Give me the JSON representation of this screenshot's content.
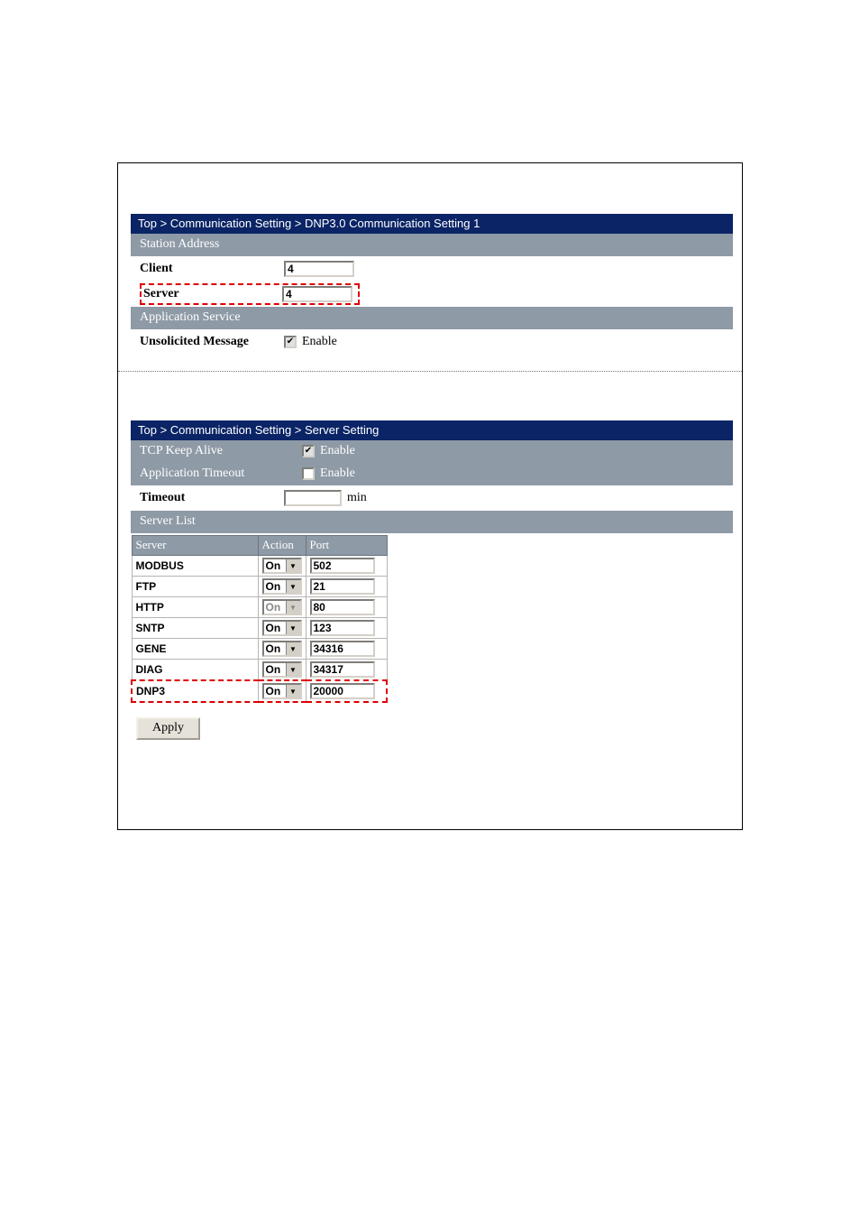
{
  "top": {
    "breadcrumb": "Top > Communication Setting > DNP3.0 Communication Setting 1",
    "section_station_address": "Station Address",
    "client_label": "Client",
    "client_value": "4",
    "server_label": "Server",
    "server_value": "4",
    "section_app_service": "Application Service",
    "unsolicited_label": "Unsolicited Message",
    "enable_label": "Enable"
  },
  "bottom": {
    "breadcrumb": "Top > Communication Setting > Server Setting",
    "tcp_keep_alive_label": "TCP Keep Alive",
    "enable_label": "Enable",
    "app_timeout_label": "Application Timeout",
    "timeout_label": "Timeout",
    "timeout_value": "",
    "timeout_unit": "min",
    "section_server_list": "Server List",
    "col_server": "Server",
    "col_action": "Action",
    "col_port": "Port",
    "rows": [
      {
        "name": "MODBUS",
        "action": "On",
        "disabled": false,
        "port": "502"
      },
      {
        "name": "FTP",
        "action": "On",
        "disabled": false,
        "port": "21"
      },
      {
        "name": "HTTP",
        "action": "On",
        "disabled": true,
        "port": "80"
      },
      {
        "name": "SNTP",
        "action": "On",
        "disabled": false,
        "port": "123"
      },
      {
        "name": "GENE",
        "action": "On",
        "disabled": false,
        "port": "34316"
      },
      {
        "name": "DIAG",
        "action": "On",
        "disabled": false,
        "port": "34317"
      },
      {
        "name": "DNP3",
        "action": "On",
        "disabled": false,
        "port": "20000"
      }
    ],
    "apply_label": "Apply"
  }
}
